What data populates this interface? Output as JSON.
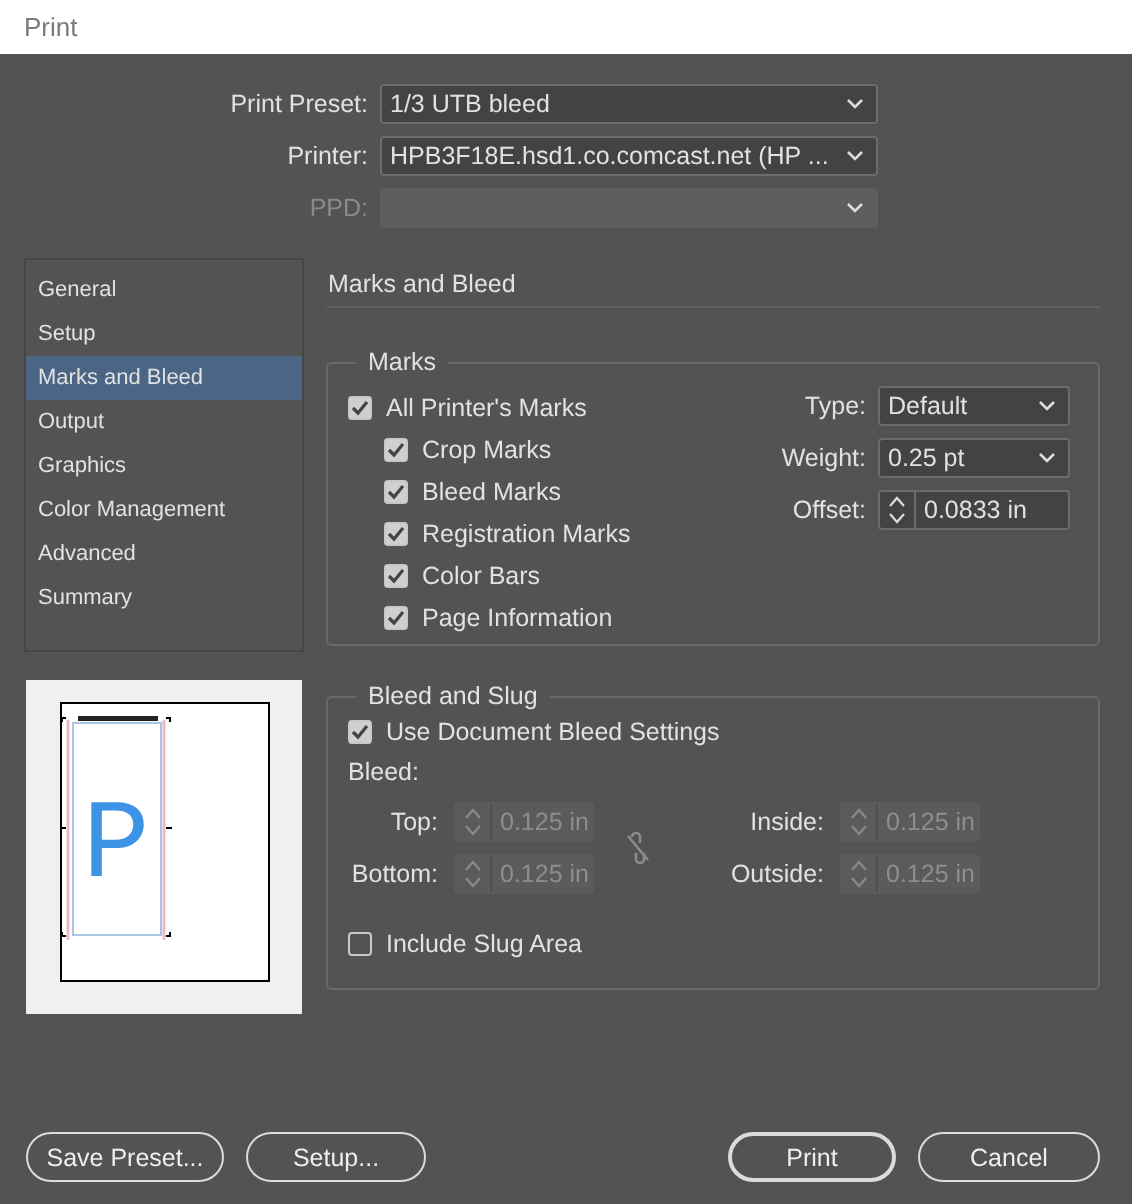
{
  "window": {
    "title": "Print"
  },
  "header_fields": [
    {
      "label": "Print Preset:",
      "value": "1/3 UTB bleed",
      "disabled": false
    },
    {
      "label": "Printer:",
      "value": "HPB3F18E.hsd1.co.comcast.net (HP ...",
      "disabled": false
    },
    {
      "label": "PPD:",
      "disabled": true
    }
  ],
  "nav": [
    {
      "label": "General",
      "selected": false
    },
    {
      "label": "Setup",
      "selected": false
    },
    {
      "label": "Marks and Bleed",
      "selected": true
    },
    {
      "label": "Output",
      "selected": false
    },
    {
      "label": "Graphics",
      "selected": false
    },
    {
      "label": "Color Management",
      "selected": false
    },
    {
      "label": "Advanced",
      "selected": false
    },
    {
      "label": "Summary",
      "selected": false
    }
  ],
  "preview": {
    "letter": "P"
  },
  "section_title": "Marks and Bleed",
  "marks": {
    "title": "Marks",
    "checkboxes": [
      {
        "label": "All Printer's Marks",
        "checked": true,
        "children": [
          {
            "label": "Crop Marks",
            "checked": true
          },
          {
            "label": "Bleed Marks",
            "checked": true
          },
          {
            "label": "Registration Marks",
            "checked": true
          },
          {
            "label": "Color Bars",
            "checked": true
          },
          {
            "label": "Page Information",
            "checked": true
          }
        ]
      }
    ],
    "settings": [
      {
        "label": "Type:",
        "kind": "dropdown",
        "value": "Default"
      },
      {
        "label": "Weight:",
        "kind": "dropdown",
        "value": "0.25 pt"
      },
      {
        "label": "Offset:",
        "kind": "spinner",
        "value": "0.0833 in"
      }
    ]
  },
  "bleed_and_slug": {
    "title": "Bleed and Slug",
    "use_document_bleed": {
      "label": "Use Document Bleed Settings",
      "checked": true
    },
    "bleed_label": "Bleed:",
    "fields": [
      {
        "label": "Top:",
        "value": "0.125 in",
        "disabled": true
      },
      {
        "label": "Inside:",
        "value": "0.125 in",
        "disabled": true
      },
      {
        "label": "Bottom:",
        "value": "0.125 in",
        "disabled": true
      },
      {
        "label": "Outside:",
        "value": "0.125 in",
        "disabled": true
      }
    ],
    "include_slug": {
      "label": "Include Slug Area",
      "checked": false
    }
  },
  "buttons": [
    {
      "label": "Save Preset...",
      "default": false
    },
    {
      "label": "Setup...",
      "default": false
    },
    {
      "label": "Print",
      "default": true
    },
    {
      "label": "Cancel",
      "default": false
    }
  ]
}
